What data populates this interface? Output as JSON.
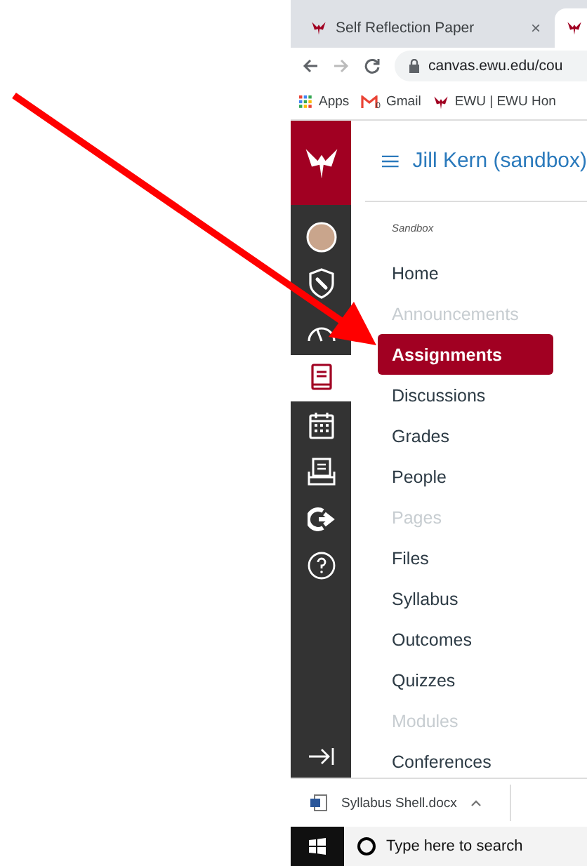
{
  "browser": {
    "tabs": [
      {
        "title": "Self Reflection Paper",
        "close": "×",
        "selected": false
      },
      {
        "selected": true
      }
    ],
    "url": "canvas.ewu.edu/cou",
    "bookmarks": [
      {
        "kind": "apps",
        "label": "Apps"
      },
      {
        "kind": "gmail",
        "label": "Gmail",
        "badge": "0"
      },
      {
        "kind": "ewu",
        "label": "EWU | EWU Hon"
      }
    ]
  },
  "global_nav": [
    {
      "kind": "avatar",
      "selected": false
    },
    {
      "kind": "account",
      "selected": false
    },
    {
      "kind": "dashboard",
      "selected": false
    },
    {
      "kind": "courses",
      "selected": true
    },
    {
      "kind": "calendar",
      "selected": false
    },
    {
      "kind": "inbox",
      "selected": false
    },
    {
      "kind": "commons",
      "selected": false
    },
    {
      "kind": "help",
      "selected": false
    }
  ],
  "course_title": "Jill Kern (sandbox)",
  "course_nav": {
    "label": "Sandbox",
    "items": [
      {
        "label": "Home",
        "selected": false,
        "disabled": false
      },
      {
        "label": "Announcements",
        "selected": false,
        "disabled": true
      },
      {
        "label": "Assignments",
        "selected": true,
        "disabled": false
      },
      {
        "label": "Discussions",
        "selected": false,
        "disabled": false
      },
      {
        "label": "Grades",
        "selected": false,
        "disabled": false
      },
      {
        "label": "People",
        "selected": false,
        "disabled": false
      },
      {
        "label": "Pages",
        "selected": false,
        "disabled": true
      },
      {
        "label": "Files",
        "selected": false,
        "disabled": false
      },
      {
        "label": "Syllabus",
        "selected": false,
        "disabled": false
      },
      {
        "label": "Outcomes",
        "selected": false,
        "disabled": false
      },
      {
        "label": "Quizzes",
        "selected": false,
        "disabled": false
      },
      {
        "label": "Modules",
        "selected": false,
        "disabled": true
      },
      {
        "label": "Conferences",
        "selected": false,
        "disabled": false
      }
    ]
  },
  "download": {
    "file": "Syllabus Shell.docx"
  },
  "taskbar": {
    "search_placeholder": "Type here to search"
  }
}
